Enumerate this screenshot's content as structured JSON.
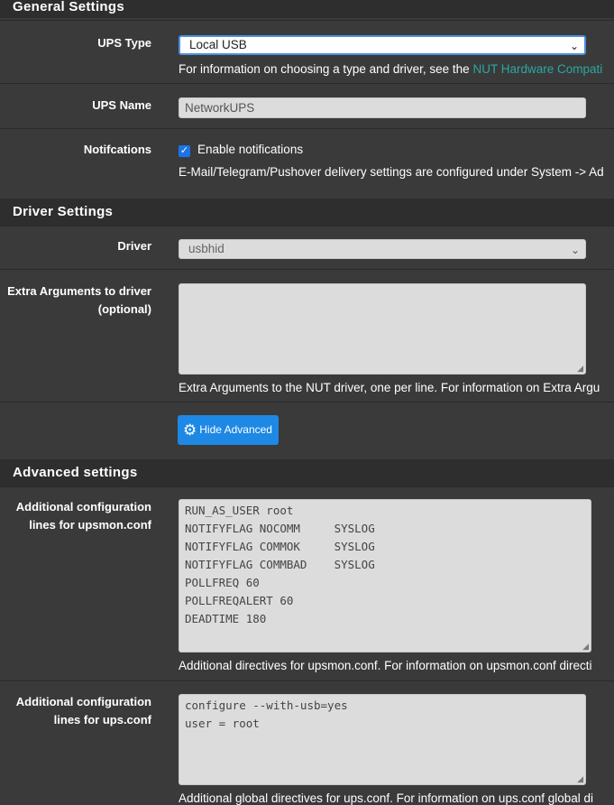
{
  "sections": {
    "general": "General Settings",
    "driver": "Driver Settings",
    "advanced": "Advanced settings"
  },
  "ups_type": {
    "label": "UPS Type",
    "value": "Local USB",
    "help_text": "For information on choosing a type and driver, see the ",
    "help_link": "NUT Hardware Compati"
  },
  "ups_name": {
    "label": "UPS Name",
    "value": "NetworkUPS"
  },
  "notifications": {
    "label": "Notifcations",
    "checkbox_label": "Enable notifications",
    "checked": true,
    "help_text": "E-Mail/Telegram/Pushover delivery settings are configured under System -> Ad"
  },
  "driver": {
    "label": "Driver",
    "value": "usbhid"
  },
  "extra_args": {
    "label_line1": "Extra Arguments to driver",
    "label_line2": "(optional)",
    "value": "",
    "help_text": "Extra Arguments to the NUT driver, one per line. For information on Extra Argu"
  },
  "advanced_button": {
    "label": "Hide Advanced",
    "icon": "gear-icon"
  },
  "upsmon": {
    "label_line1": "Additional configuration",
    "label_line2": "lines for upsmon.conf",
    "value": "RUN_AS_USER root\nNOTIFYFLAG NOCOMM     SYSLOG\nNOTIFYFLAG COMMOK     SYSLOG\nNOTIFYFLAG COMMBAD    SYSLOG\nPOLLFREQ 60\nPOLLFREQALERT 60\nDEADTIME 180",
    "help_text": "Additional directives for upsmon.conf. For information on upsmon.conf directi"
  },
  "ups_conf": {
    "label_line1": "Additional configuration",
    "label_line2": "lines for ups.conf",
    "value": "configure --with-usb=yes\nuser = root",
    "help_text": "Additional global directives for ups.conf. For information on ups.conf global di"
  },
  "colors": {
    "background": "#3a3a3a",
    "heading": "#2e2e2e",
    "link": "#2aa8a3",
    "button": "#1e88e5",
    "focus": "#4a90e2"
  }
}
